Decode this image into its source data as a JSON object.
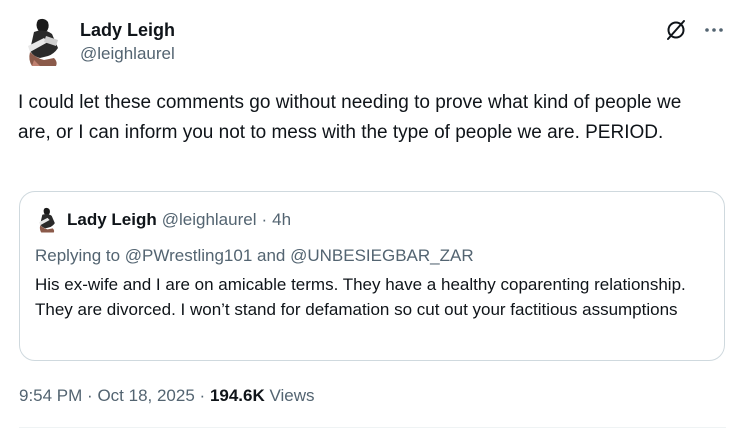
{
  "author": {
    "display_name": "Lady Leigh",
    "handle": "@leighlaurel"
  },
  "tweet": {
    "text": "I could let these comments go without needing to prove what kind of people we are, or I can inform you not to mess with the type of people we are. PERIOD."
  },
  "quote": {
    "display_name": "Lady Leigh",
    "handle": "@leighlaurel",
    "separator": "·",
    "time": "4h",
    "replying_prefix": "Replying to ",
    "mention_1": "@PWrestling101",
    "and": " and ",
    "mention_2": "@UNBESIEGBAR_ZAR",
    "text": "His ex-wife and I are on amicable terms. They have a healthy coparenting relationship. They are divorced. I won’t stand for defamation so cut out your factitious assumptions"
  },
  "meta": {
    "time": "9:54 PM",
    "separator": "·",
    "date": "Oct 18, 2025",
    "views_count": "194.6K",
    "views_label": "Views"
  },
  "icons": {
    "grok": "grok-icon",
    "more": "more-icon"
  },
  "colors": {
    "text_primary": "#0f1419",
    "text_secondary": "#536471",
    "border": "#cfd9de"
  }
}
